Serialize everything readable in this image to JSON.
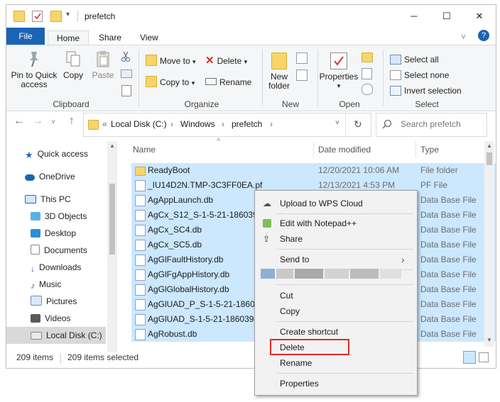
{
  "title_bar": {
    "title": "prefetch",
    "minimize": "─",
    "maximize": "☐",
    "close": "✕"
  },
  "tabs": {
    "file": "File",
    "home": "Home",
    "share": "Share",
    "view": "View",
    "help": "?"
  },
  "ribbon": {
    "pin_quick_access_line1": "Pin to Quick",
    "pin_quick_access_line2": "access",
    "copy": "Copy",
    "paste": "Paste",
    "clipboard": "Clipboard",
    "move_to": "Move to",
    "copy_to": "Copy to",
    "delete": "Delete",
    "rename": "Rename",
    "organize": "Organize",
    "new_folder_line1": "New",
    "new_folder_line2": "folder",
    "new": "New",
    "properties": "Properties",
    "open": "Open",
    "select_all": "Select all",
    "select_none": "Select none",
    "invert_selection": "Invert selection",
    "select": "Select"
  },
  "address": {
    "chevrons": "«",
    "crumbs": [
      "Local Disk (C:)",
      "Windows",
      "prefetch"
    ],
    "search_placeholder": "Search prefetch"
  },
  "nav_pane": {
    "items": [
      "Quick access",
      "OneDrive",
      "This PC",
      "3D Objects",
      "Desktop",
      "Documents",
      "Downloads",
      "Music",
      "Pictures",
      "Videos",
      "Local Disk (C:)"
    ]
  },
  "columns": {
    "name": "Name",
    "date_modified": "Date modified",
    "type": "Type"
  },
  "files": [
    {
      "name": "ReadyBoot",
      "date": "12/20/2021 10:06 AM",
      "type": "File folder"
    },
    {
      "name": "_IU14D2N.TMP-3C3FF0EA.pf",
      "date": "12/13/2021 4:53 PM",
      "type": "PF File"
    },
    {
      "name": "AgAppLaunch.db",
      "date": "",
      "type": "Data Base File"
    },
    {
      "name": "AgCx_S12_S-1-5-21-18603945",
      "date": "",
      "type": "Data Base File"
    },
    {
      "name": "AgCx_SC4.db",
      "date": "",
      "type": "Data Base File"
    },
    {
      "name": "AgCx_SC5.db",
      "date": "",
      "type": "Data Base File"
    },
    {
      "name": "AgGlFaultHistory.db",
      "date": "",
      "type": "Data Base File"
    },
    {
      "name": "AgGlFgAppHistory.db",
      "date": "",
      "type": "Data Base File"
    },
    {
      "name": "AgGlGlobalHistory.db",
      "date": "",
      "type": "Data Base File"
    },
    {
      "name": "AgGlUAD_P_S-1-5-21-186039",
      "date": "",
      "type": "Data Base File"
    },
    {
      "name": "AgGlUAD_S-1-5-21-18603945",
      "date": "",
      "type": "Data Base File"
    },
    {
      "name": "AgRobust.db",
      "date": "",
      "type": "Data Base File"
    }
  ],
  "status": {
    "count": "209 items",
    "selected": "209 items selected"
  },
  "context_menu": {
    "upload_wps": "Upload to WPS Cloud",
    "edit_notepad": "Edit with Notepad++",
    "share": "Share",
    "send_to": "Send to",
    "cut": "Cut",
    "copy": "Copy",
    "create_shortcut": "Create shortcut",
    "delete": "Delete",
    "rename": "Rename",
    "properties": "Properties"
  },
  "colors": {
    "accent": "#1b64b5",
    "selection": "#cce8ff",
    "highlight_box": "#e02b27",
    "folder": "#f7d56b"
  }
}
